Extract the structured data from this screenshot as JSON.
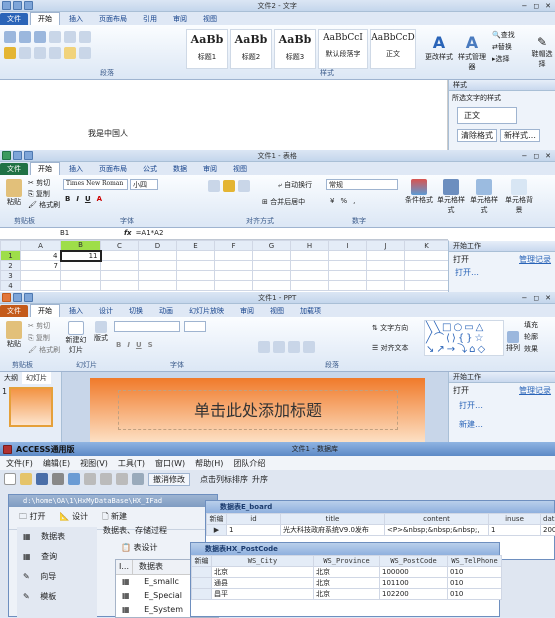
{
  "word": {
    "title": "文件2 - 文字",
    "tabs": [
      "文件",
      "开始",
      "插入",
      "页面布局",
      "引用",
      "审阅",
      "视图"
    ],
    "styles": [
      {
        "preview": "AaBb",
        "name": "标题1"
      },
      {
        "preview": "AaBb",
        "name": "标题2"
      },
      {
        "preview": "AaBb",
        "name": "标题3"
      },
      {
        "preview": "AaBbCcI",
        "name": "默认段落字"
      },
      {
        "preview": "AaBbCcD",
        "name": "正文"
      }
    ],
    "change_styles": "更改样式",
    "style_manager": "样式管理器",
    "find": "查找",
    "replace": "替换",
    "select": "选择",
    "erase": "鞋帽选择",
    "group_para": "段落",
    "group_styles": "样式",
    "doc_text": "我是中国人",
    "styles_pane": {
      "title": "样式",
      "subtitle": "所选文字的样式",
      "current": "正文",
      "clear": "清除格式",
      "new": "新样式…"
    }
  },
  "excel": {
    "title": "文件1 - 表格",
    "tabs": [
      "文件",
      "开始",
      "插入",
      "页面布局",
      "公式",
      "数据",
      "审阅",
      "视图"
    ],
    "clipboard": {
      "paste": "粘贴",
      "cut": "剪切",
      "copy": "复制",
      "format": "格式刷",
      "group": "剪贴板"
    },
    "font_name": "Times New Roman",
    "font_size": "小四",
    "group_font": "字体",
    "group_align": "对齐方式",
    "group_number": "数字",
    "wrap": "自动换行",
    "merge": "合并后居中",
    "numfmt": "常规",
    "cond": "条件格式",
    "table": "单元格样式",
    "cellfmt": "单元格样式",
    "cellbg": "单元格背景",
    "name_box": "B1",
    "formula": "=A1*A2",
    "columns": [
      "A",
      "B",
      "C",
      "D",
      "E",
      "F",
      "G",
      "H",
      "I",
      "J",
      "K"
    ],
    "rows": [
      {
        "n": "1",
        "a": "4",
        "b": "11"
      },
      {
        "n": "2",
        "a": "7",
        "b": ""
      },
      {
        "n": "3",
        "a": "",
        "b": ""
      },
      {
        "n": "4",
        "a": "",
        "b": ""
      },
      {
        "n": "5",
        "a": "",
        "b": ""
      }
    ],
    "pane": {
      "title": "开始工作",
      "open": "打开",
      "manage": "管理记录",
      "open2": "打开…"
    }
  },
  "ppt": {
    "title": "文件1 - PPT",
    "tabs": [
      "文件",
      "开始",
      "插入",
      "设计",
      "切换",
      "动画",
      "幻灯片放映",
      "审阅",
      "视图",
      "加载项"
    ],
    "paste": "粘贴",
    "cut": "剪切",
    "copy": "复制",
    "format": "格式刷",
    "new_slide": "新建幻灯片",
    "layout": "版式",
    "group_clip": "剪贴板",
    "group_slides": "幻灯片",
    "group_font": "字体",
    "group_para": "段落",
    "text_dir": "文字方向",
    "align_text": "对齐文本",
    "arrange": "排列",
    "shapes": "形状",
    "fill": "填充",
    "outline": "轮廓",
    "effect": "效果",
    "side_tabs": [
      "大纲",
      "幻灯片"
    ],
    "slide_num": "1",
    "placeholder": "单击此处添加标题",
    "pane": {
      "title": "开始工作",
      "open": "打开",
      "manage": "管理记录",
      "open2": "打开…",
      "new": "新建…"
    }
  },
  "access": {
    "title": "ACCESS通用版",
    "doc_title": "文件1 - 数据库",
    "menu": [
      "文件(F)",
      "编辑(E)",
      "视图(V)",
      "工具(T)",
      "窗口(W)",
      "帮助(H)",
      "团队介绍"
    ],
    "undo": "撤消修改",
    "sort": "点击列标排序",
    "asc": "升序",
    "db_window": {
      "title": "d:\\home\\OA\\1\\HxMyDataBase\\HX_IFad",
      "open": "打开",
      "design": "设计",
      "new": "新建",
      "nav": [
        "数据表",
        "查询",
        "向导",
        "模板"
      ],
      "subtitle": "数据表、存储过程",
      "table_design": "表设计",
      "col_header": "数据表",
      "tables": [
        "E_smallc",
        "E_Special",
        "E_System"
      ]
    },
    "board": {
      "title": "数据表E_board",
      "cols": [
        "id",
        "title",
        "content",
        "inuse",
        "dat"
      ],
      "row": [
        "1",
        "光大科技政府系统V9.0发布",
        "<P>&nbsp;&nbsp;&nbsp;,",
        "1",
        "2008"
      ]
    },
    "postcode": {
      "title": "数据表HX_PostCode",
      "cols": [
        "WS_City",
        "WS_Province",
        "WS_PostCode",
        "WS_TelPhone"
      ],
      "rows": [
        [
          "北京",
          "北京",
          "100000",
          "010"
        ],
        [
          "通县",
          "北京",
          "101100",
          "010"
        ],
        [
          "昌平",
          "北京",
          "102200",
          "010"
        ]
      ]
    }
  },
  "colors": {
    "accent": "#2a64b8",
    "excel": "#207245",
    "ppt": "#c45a1a",
    "access": "#a33"
  }
}
